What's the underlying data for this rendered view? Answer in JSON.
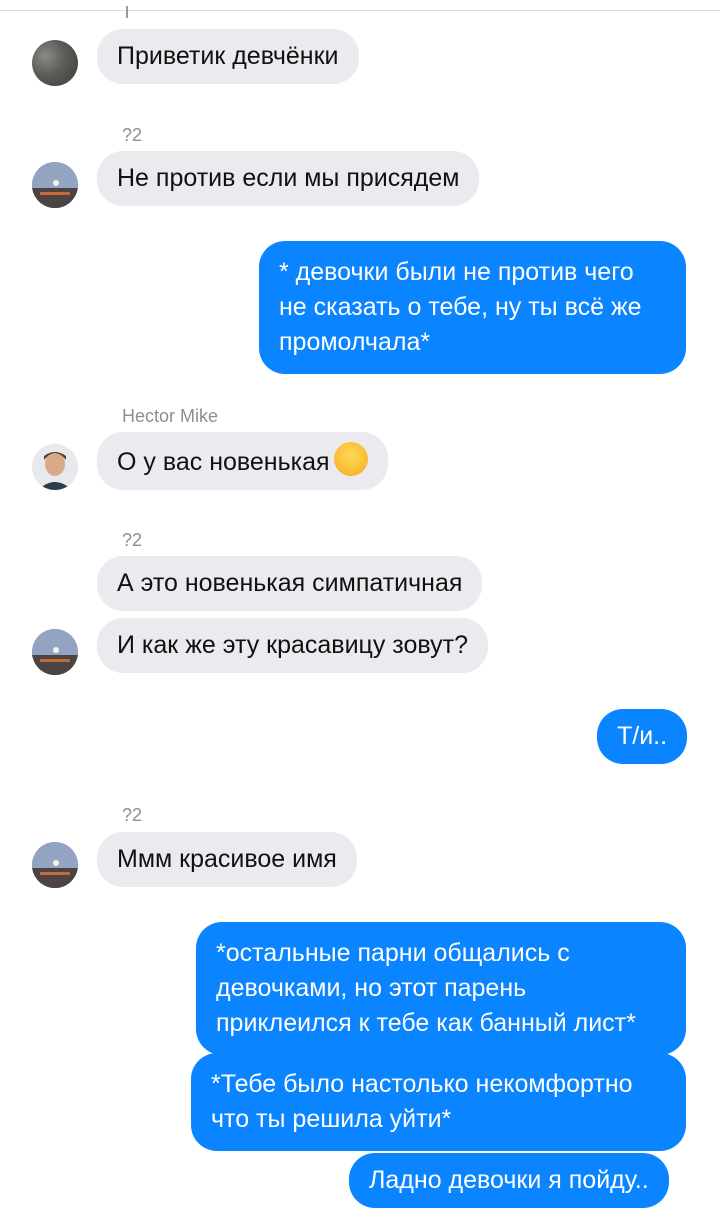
{
  "chat": {
    "messages": [
      {
        "sender": "",
        "text": "Приветик девчёнки"
      },
      {
        "sender": "?2",
        "text": "Не против если мы присядем"
      },
      {
        "sender": "",
        "text": "* девочки были не против чего не сказать о тебе, ну ты всё же промолчала*"
      },
      {
        "sender": "Hector Mike",
        "text": "О у вас новенькая",
        "emoji": "smirking-face"
      },
      {
        "sender": "?2",
        "text": "А это новенькая симпатичная"
      },
      {
        "sender": "",
        "text": "И как же эту красавицу зовут?"
      },
      {
        "sender": "",
        "text": "Т/и.."
      },
      {
        "sender": "?2",
        "text": "Ммм красивое имя"
      },
      {
        "sender": "",
        "text": "*остальные парни общались с девочками, но этот парень приклеился к тебе как банный лист*"
      },
      {
        "sender": "",
        "text": "*Тебе было настолько некомфортно что ты решила уйти*"
      },
      {
        "sender": "",
        "text": "Ладно девочки я пойду.."
      }
    ]
  },
  "colors": {
    "outgoing": "#0a84ff",
    "incoming": "#ebebef",
    "sender_label": "#8e8e93"
  }
}
